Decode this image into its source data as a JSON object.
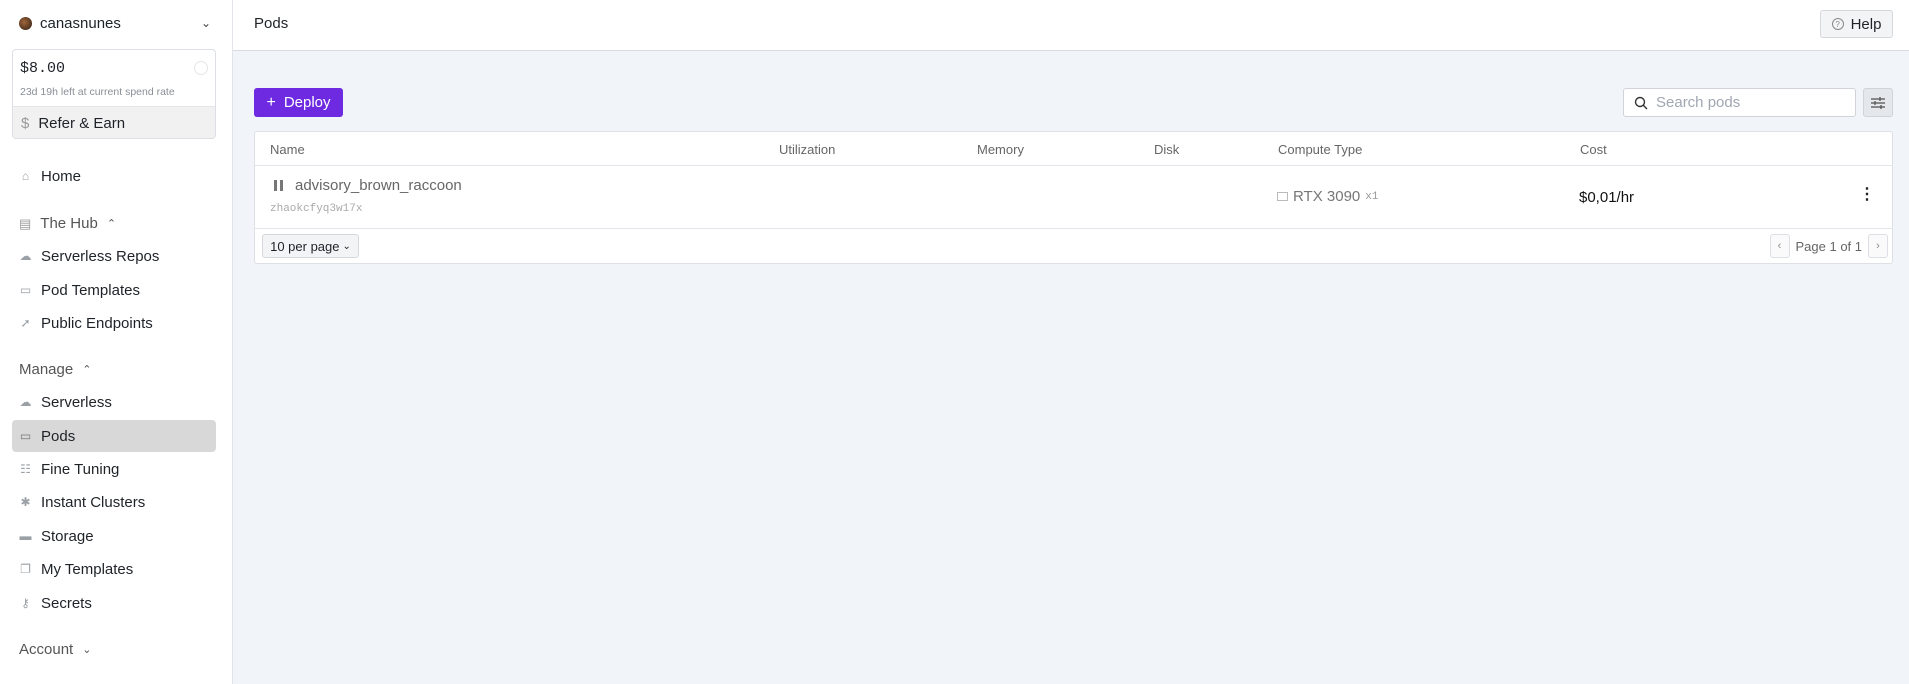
{
  "user": {
    "name": "canasnunes"
  },
  "credit": {
    "amount": "$8.00",
    "time_left": "23d 19h left at current spend rate",
    "refer_label": "Refer & Earn"
  },
  "sidebar": {
    "home": "Home",
    "hub": {
      "label": "The Hub",
      "items": [
        "Serverless Repos",
        "Pod Templates",
        "Public Endpoints"
      ]
    },
    "manage": {
      "label": "Manage",
      "items": [
        "Serverless",
        "Pods",
        "Fine Tuning",
        "Instant Clusters",
        "Storage",
        "My Templates",
        "Secrets"
      ]
    },
    "account": "Account",
    "active": "Pods"
  },
  "header": {
    "title": "Pods",
    "help_label": "Help"
  },
  "toolbar": {
    "deploy_label": "Deploy",
    "search_placeholder": "Search pods"
  },
  "table": {
    "columns": [
      "Name",
      "Utilization",
      "Memory",
      "Disk",
      "Compute Type",
      "Cost"
    ],
    "rows": [
      {
        "name": "advisory_brown_raccoon",
        "id": "zhaokcfyq3w17x",
        "status": "paused",
        "gpu": "RTX 3090",
        "gpu_count": "x1",
        "cost": "$0,01/hr"
      }
    ],
    "per_page": "10 per page",
    "page_info": "Page 1 of 1"
  },
  "colors": {
    "accent": "#6d2ae0"
  }
}
